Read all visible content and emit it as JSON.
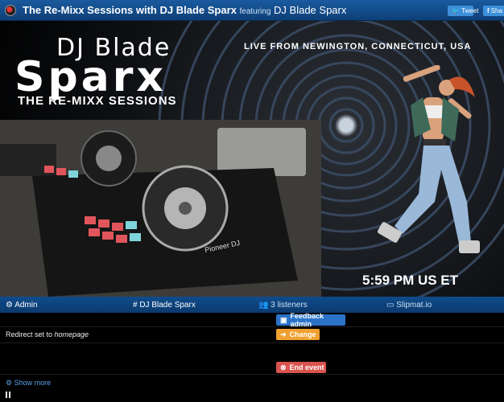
{
  "header": {
    "title": "The Re-Mixx Sessions with DJ Blade Sparx",
    "featuring_label": "featuring",
    "featuring_name": "DJ Blade Sparx",
    "tweet_label": "Tweet",
    "share_label": "Sha"
  },
  "hero": {
    "logo_line1": "DJ Blade",
    "logo_line2": "Sparx",
    "logo_line3": "THE RE-MIXX SESSIONS",
    "location": "LIVE FROM NEWINGTON, CONNECTICUT, USA",
    "time": "5:59 PM US ET",
    "equipment_brand": "Pioneer DJ"
  },
  "nav": {
    "admin": "Admin",
    "dj": "# DJ Blade Sparx",
    "listeners": "3 listeners",
    "slipmat": "Slipmat.io"
  },
  "admin": {
    "feedback_btn": "Feedback admin",
    "change_btn": "Change",
    "end_btn": "End event",
    "redirect_text": "Redirect set to ",
    "redirect_target": "homepage",
    "show_more": "Show more"
  },
  "colors": {
    "topbar": "#1a5a9e",
    "feedback": "#2a73c9",
    "change": "#f0a030",
    "end": "#d9534f",
    "link": "#5aa0e8"
  }
}
